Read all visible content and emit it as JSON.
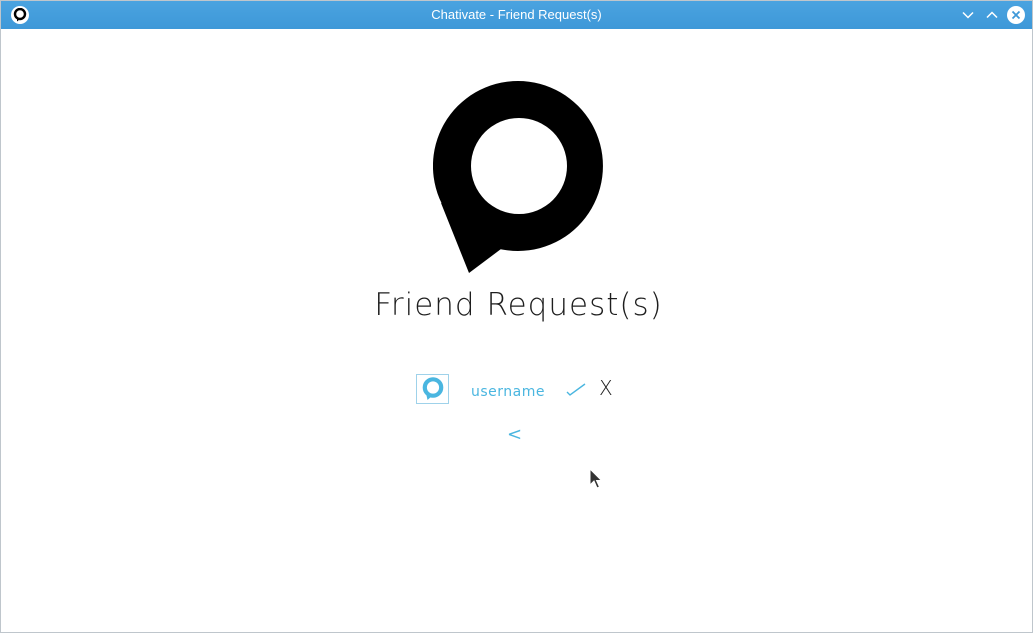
{
  "window": {
    "title": "Chativate - Friend Request(s)"
  },
  "page": {
    "title": "Friend Request(s)"
  },
  "request": {
    "username": "username",
    "accept_icon": "checkmark-icon",
    "reject_label": "X"
  },
  "nav": {
    "back_label": "<"
  },
  "colors": {
    "titlebar": "#3e98d8",
    "accent": "#4ab6e0",
    "logo": "#000000"
  }
}
